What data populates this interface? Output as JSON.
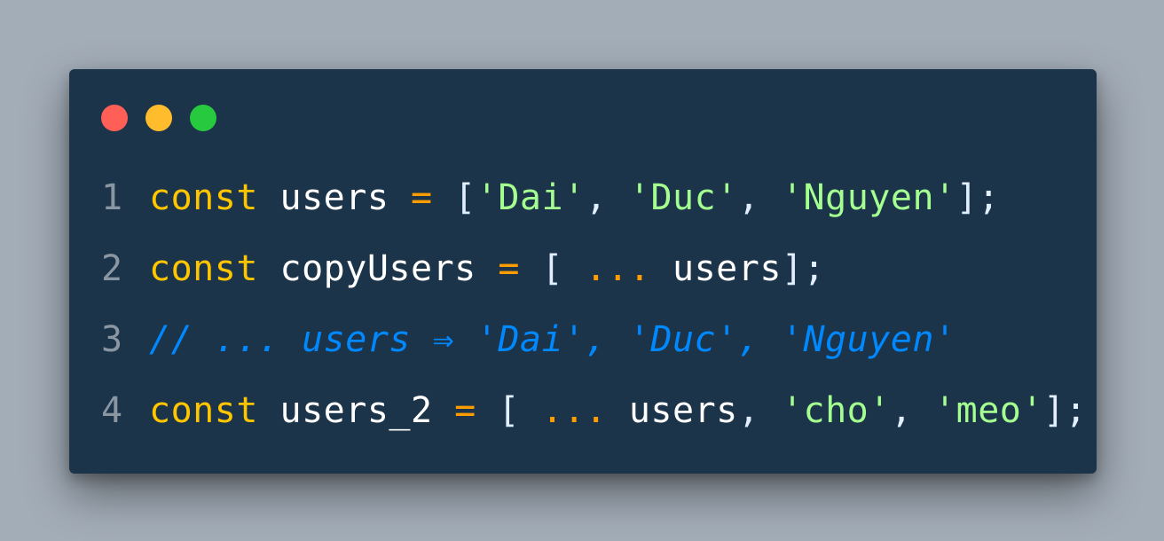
{
  "window": {
    "controls": [
      {
        "name": "close",
        "color": "#ff5f56"
      },
      {
        "name": "minimize",
        "color": "#ffbd2e"
      },
      {
        "name": "maximize",
        "color": "#27c93f"
      }
    ]
  },
  "theme": {
    "background": "#1b3449",
    "keyword": "#ffc600",
    "string": "#a5ff90",
    "comment": "#0088ff",
    "operator": "#ff9d00",
    "line_number": "#8b96a3"
  },
  "code": {
    "lines": [
      {
        "number": "1",
        "tokens": [
          {
            "type": "keyword",
            "text": "const"
          },
          {
            "type": "ident",
            "text": " users "
          },
          {
            "type": "op",
            "text": "="
          },
          {
            "type": "punct",
            "text": " ["
          },
          {
            "type": "string",
            "text": "'Dai'"
          },
          {
            "type": "punct",
            "text": ", "
          },
          {
            "type": "string",
            "text": "'Duc'"
          },
          {
            "type": "punct",
            "text": ", "
          },
          {
            "type": "string",
            "text": "'Nguyen'"
          },
          {
            "type": "punct",
            "text": "];"
          }
        ]
      },
      {
        "number": "2",
        "tokens": [
          {
            "type": "keyword",
            "text": "const"
          },
          {
            "type": "ident",
            "text": " copyUsers "
          },
          {
            "type": "op",
            "text": "="
          },
          {
            "type": "punct",
            "text": " [ "
          },
          {
            "type": "op",
            "text": "..."
          },
          {
            "type": "ident",
            "text": " users"
          },
          {
            "type": "punct",
            "text": "];"
          }
        ]
      },
      {
        "number": "3",
        "tokens": [
          {
            "type": "comment",
            "text": "// ... users ⇒ 'Dai', 'Duc', 'Nguyen'"
          }
        ]
      },
      {
        "number": "4",
        "tokens": [
          {
            "type": "keyword",
            "text": "const"
          },
          {
            "type": "ident",
            "text": " users_2 "
          },
          {
            "type": "op",
            "text": "="
          },
          {
            "type": "punct",
            "text": " [ "
          },
          {
            "type": "op",
            "text": "..."
          },
          {
            "type": "ident",
            "text": " users"
          },
          {
            "type": "punct",
            "text": ", "
          },
          {
            "type": "string",
            "text": "'cho'"
          },
          {
            "type": "punct",
            "text": ", "
          },
          {
            "type": "string",
            "text": "'meo'"
          },
          {
            "type": "punct",
            "text": "];"
          }
        ]
      }
    ]
  }
}
